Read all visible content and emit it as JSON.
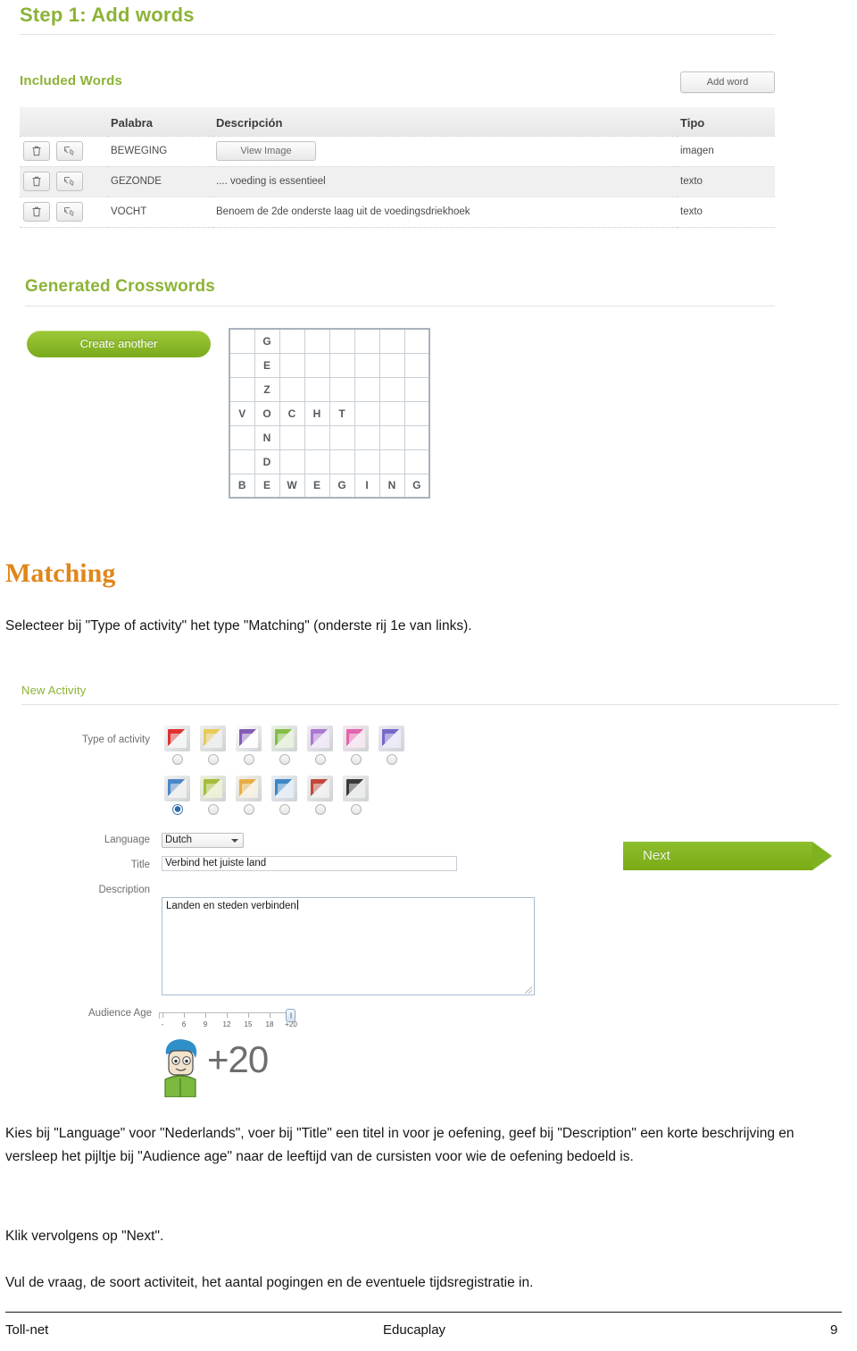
{
  "step1": {
    "heading": "Step 1: Add words",
    "included_words_label": "Included Words",
    "add_word_label": "Add word",
    "table": {
      "columns": [
        "",
        "Palabra",
        "Descripción",
        "Tipo"
      ],
      "rows": [
        {
          "word": "BEWEGING",
          "description": "View Image",
          "desc_is_button": "true",
          "type": "imagen"
        },
        {
          "word": "GEZONDE",
          "description": ".... voeding is essentieel",
          "desc_is_button": "false",
          "type": "texto"
        },
        {
          "word": "VOCHT",
          "description": "Benoem de 2de onderste laag uit de voedingsdriekhoek",
          "desc_is_button": "false",
          "type": "texto"
        }
      ]
    },
    "row_icons": {
      "delete": "trash-icon",
      "edit": "edit-icon"
    }
  },
  "crosswords": {
    "heading": "Generated Crosswords",
    "create_another_label": "Create another",
    "grid": {
      "cols": 8,
      "rows": 7,
      "cells": [
        [
          "",
          "G",
          "",
          "",
          "",
          "",
          "",
          ""
        ],
        [
          "",
          "E",
          "",
          "",
          "",
          "",
          "",
          ""
        ],
        [
          "",
          "Z",
          "",
          "",
          "",
          "",
          "",
          ""
        ],
        [
          "V",
          "O",
          "C",
          "H",
          "T",
          "",
          "",
          ""
        ],
        [
          "",
          "N",
          "",
          "",
          "",
          "",
          "",
          ""
        ],
        [
          "",
          "D",
          "",
          "",
          "",
          "",
          "",
          ""
        ],
        [
          "B",
          "E",
          "W",
          "E",
          "G",
          "I",
          "N",
          "G"
        ]
      ]
    }
  },
  "matching": {
    "heading": "Matching",
    "intro": "Selecteer bij \"Type of activity\" het type \"Matching\" (onderste rij 1e van links)."
  },
  "new_activity": {
    "panel_title": "New Activity",
    "type_of_activity_label": "Type of activity",
    "type_row1_count": 7,
    "type_row2_count": 6,
    "selected_type_index": 7,
    "language_label": "Language",
    "language_value": "Dutch",
    "title_label": "Title",
    "title_value": "Verbind het juiste land",
    "description_label": "Description",
    "description_value": "Landen en steden verbinden",
    "next_label": "Next",
    "audience_age_label": "Audience Age",
    "age_ticks": [
      "-",
      "6",
      "9",
      "12",
      "15",
      "18",
      "+20"
    ],
    "age_value": "+20"
  },
  "body_text": {
    "p1": "Kies bij \"Language\" voor \"Nederlands\", voer bij \"Title\" een titel in voor je oefening, geef bij \"Description\" een korte beschrijving en versleep het pijltje bij \"Audience age\" naar de leeftijd van de cursisten voor wie de oefening bedoeld is.",
    "p2": "Klik vervolgens op \"Next\".",
    "p3": "Vul de vraag, de soort activiteit, het aantal pogingen en de eventuele tijdsregistratie in."
  },
  "footer": {
    "left": "Toll-net",
    "center": "Educaplay",
    "right": "9"
  },
  "colors": {
    "green_heading": "#8cb336",
    "orange_heading": "#e0861a",
    "button_green": "#80b220"
  }
}
